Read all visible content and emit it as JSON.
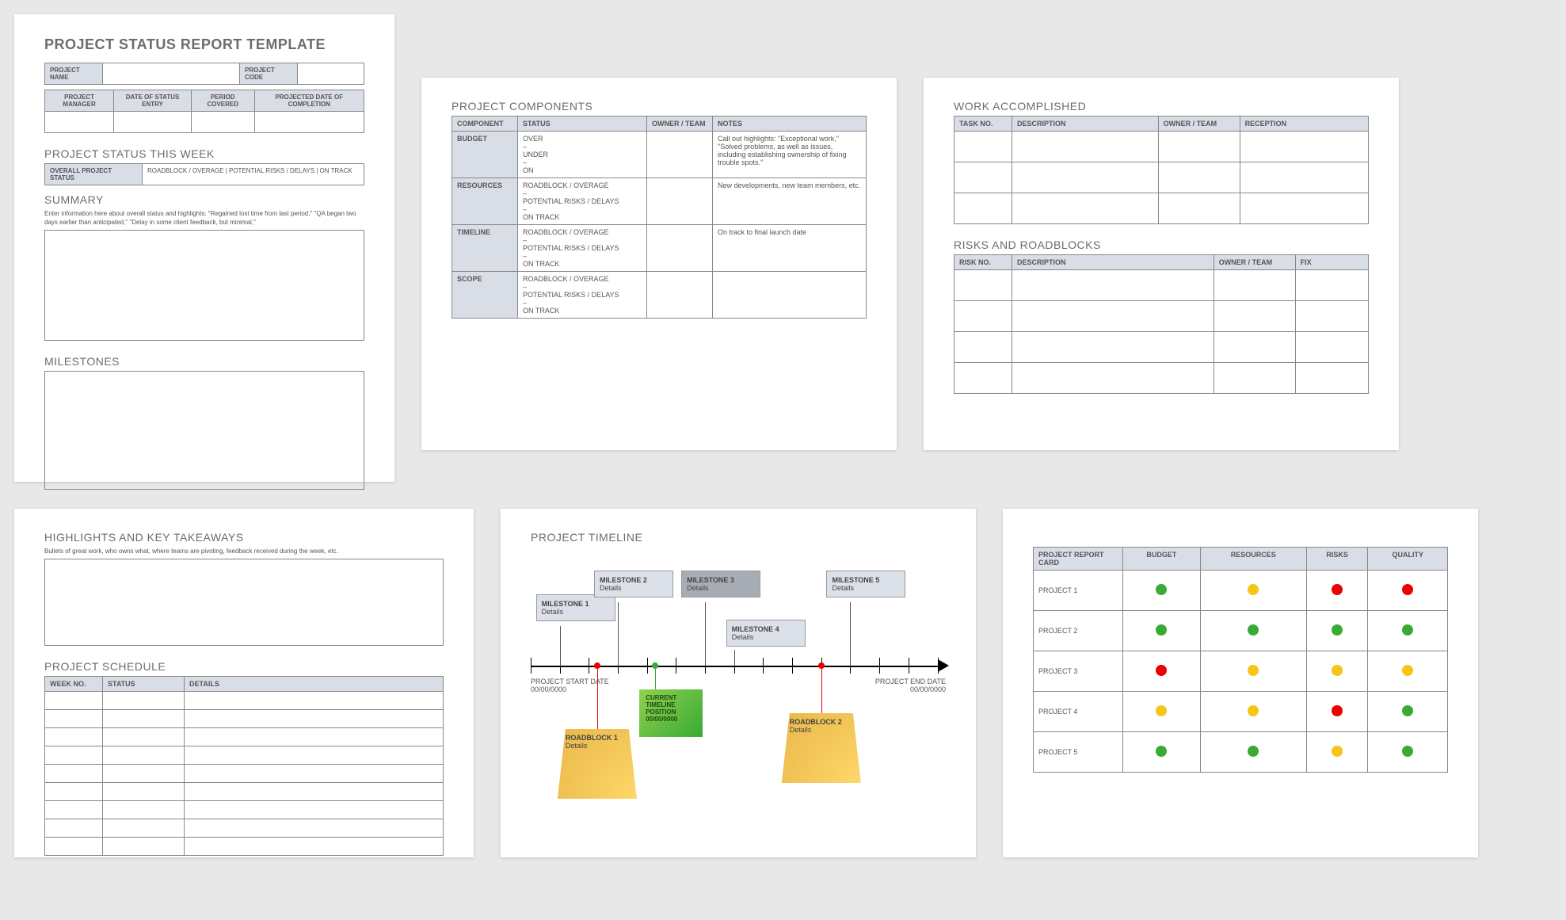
{
  "page1": {
    "title": "PROJECT STATUS REPORT TEMPLATE",
    "name_lbl": "PROJECT NAME",
    "code_lbl": "PROJECT CODE",
    "mgr_lbl": "PROJECT MANAGER",
    "entry_lbl": "DATE OF STATUS ENTRY",
    "period_lbl": "PERIOD COVERED",
    "complete_lbl": "PROJECTED DATE OF COMPLETION",
    "status_week": "PROJECT STATUS THIS WEEK",
    "overall_lbl": "OVERALL PROJECT STATUS",
    "legend": "ROADBLOCK / OVERAGE   |   POTENTIAL RISKS / DELAYS   |   ON TRACK",
    "summary_lbl": "SUMMARY",
    "summary_hint": "Enter information here about overall status and highlights: \"Regained lost time from last period,\" \"QA began two days earlier than anticipated,\" \"Delay in some client feedback, but minimal,\"",
    "milestones_lbl": "MILESTONES"
  },
  "page2": {
    "title": "PROJECT COMPONENTS",
    "cols": {
      "c0": "COMPONENT",
      "c1": "STATUS",
      "c2": "OWNER / TEAM",
      "c3": "NOTES"
    },
    "rows": [
      {
        "comp": "BUDGET",
        "status": "OVER\n–\nUNDER\n–\nON",
        "notes": "Call out highlights: \"Exceptional work,\" \"Solved problems, as well as issues, including establishing ownership of fixing trouble spots.\""
      },
      {
        "comp": "RESOURCES",
        "status": "ROADBLOCK / OVERAGE\n–\nPOTENTIAL RISKS / DELAYS\n–\nON TRACK",
        "notes": "New developments, new team members, etc."
      },
      {
        "comp": "TIMELINE",
        "status": "ROADBLOCK / OVERAGE\n–\nPOTENTIAL RISKS / DELAYS\n–\nON TRACK",
        "notes": "On track to final launch date"
      },
      {
        "comp": "SCOPE",
        "status": "ROADBLOCK / OVERAGE\n–\nPOTENTIAL RISKS / DELAYS\n–\nON TRACK",
        "notes": ""
      }
    ]
  },
  "page3": {
    "wa_title": "WORK ACCOMPLISHED",
    "wa_cols": {
      "c0": "TASK NO.",
      "c1": "DESCRIPTION",
      "c2": "OWNER / TEAM",
      "c3": "RECEPTION"
    },
    "rr_title": "RISKS AND ROADBLOCKS",
    "rr_cols": {
      "c0": "RISK NO.",
      "c1": "DESCRIPTION",
      "c2": "OWNER / TEAM",
      "c3": "FIX"
    }
  },
  "page4": {
    "hl_title": "HIGHLIGHTS AND KEY TAKEAWAYS",
    "hl_hint": "Bullets of great work, who owns what, where teams are pivoting, feedback received during the week, etc.",
    "sched_title": "PROJECT SCHEDULE",
    "sched_cols": {
      "c0": "WEEK NO.",
      "c1": "STATUS",
      "c2": "DETAILS"
    }
  },
  "page5": {
    "title": "PROJECT TIMELINE",
    "ms": [
      {
        "t": "MILESTONE 1",
        "d": "Details"
      },
      {
        "t": "MILESTONE 2",
        "d": "Details"
      },
      {
        "t": "MILESTONE 3",
        "d": "Details"
      },
      {
        "t": "MILESTONE 4",
        "d": "Details"
      },
      {
        "t": "MILESTONE 5",
        "d": "Details"
      }
    ],
    "rb": [
      {
        "t": "ROADBLOCK 1",
        "d": "Details"
      },
      {
        "t": "ROADBLOCK 2",
        "d": "Details"
      }
    ],
    "cur_t": "CURRENT TIMELINE POSITION",
    "cur_d": "00/00/0000",
    "start_t": "PROJECT START DATE",
    "start_d": "00/00/0000",
    "end_t": "PROJECT END DATE",
    "end_d": "00/00/0000"
  },
  "page6": {
    "title": "PROJECT REPORT CARD",
    "cols": {
      "c0": "BUDGET",
      "c1": "RESOURCES",
      "c2": "RISKS",
      "c3": "QUALITY"
    },
    "rows": [
      {
        "name": "PROJECT 1",
        "vals": [
          "g",
          "y",
          "r",
          "r"
        ]
      },
      {
        "name": "PROJECT 2",
        "vals": [
          "g",
          "g",
          "g",
          "g"
        ]
      },
      {
        "name": "PROJECT 3",
        "vals": [
          "r",
          "y",
          "y",
          "y"
        ]
      },
      {
        "name": "PROJECT 4",
        "vals": [
          "y",
          "y",
          "r",
          "g"
        ]
      },
      {
        "name": "PROJECT 5",
        "vals": [
          "g",
          "g",
          "y",
          "g"
        ]
      }
    ]
  }
}
